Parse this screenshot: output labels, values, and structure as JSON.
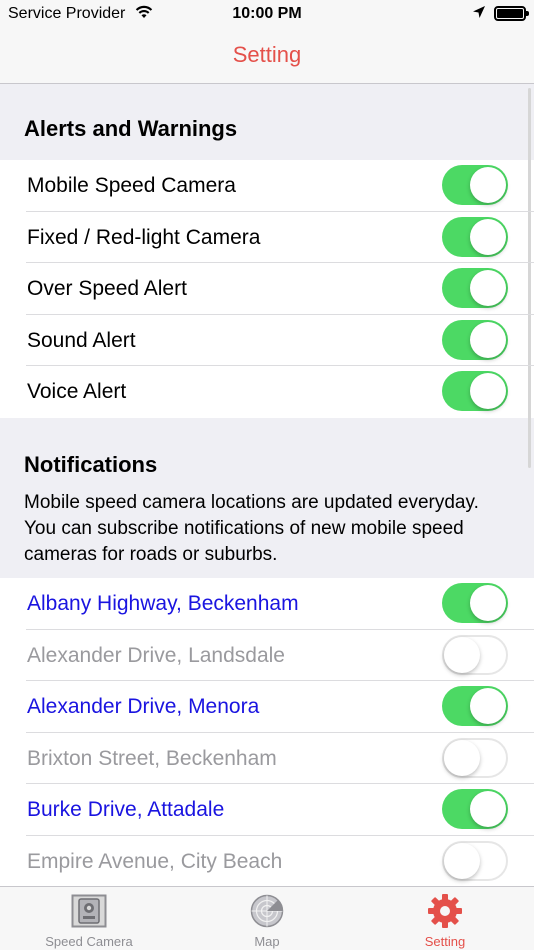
{
  "status_bar": {
    "carrier": "Service Provider",
    "time": "10:00 PM"
  },
  "nav": {
    "title": "Setting"
  },
  "alerts": {
    "header": "Alerts and Warnings",
    "items": [
      {
        "label": "Mobile Speed Camera",
        "enabled": true
      },
      {
        "label": "Fixed / Red-light Camera",
        "enabled": true
      },
      {
        "label": "Over Speed Alert",
        "enabled": true
      },
      {
        "label": "Sound Alert",
        "enabled": true
      },
      {
        "label": "Voice Alert",
        "enabled": true
      }
    ]
  },
  "notifications": {
    "header": "Notifications",
    "description": "Mobile speed camera locations are updated everyday. You can subscribe notifications of new mobile speed cameras for roads or suburbs.",
    "items": [
      {
        "label": "Albany Highway, Beckenham",
        "enabled": true
      },
      {
        "label": "Alexander Drive, Landsdale",
        "enabled": false
      },
      {
        "label": "Alexander Drive, Menora",
        "enabled": true
      },
      {
        "label": "Brixton Street, Beckenham",
        "enabled": false
      },
      {
        "label": "Burke Drive, Attadale",
        "enabled": true
      },
      {
        "label": "Empire Avenue, City Beach",
        "enabled": false
      }
    ]
  },
  "tabs": [
    {
      "label": "Speed Camera",
      "icon": "speed-camera-icon",
      "active": false
    },
    {
      "label": "Map",
      "icon": "radar-icon",
      "active": false
    },
    {
      "label": "Setting",
      "icon": "gear-icon",
      "active": true
    }
  ],
  "colors": {
    "accent": "#e4504a",
    "toggle_on": "#4cd964",
    "subscribed_text": "#1a14e0",
    "unsubscribed_text": "#9a9a9e"
  }
}
